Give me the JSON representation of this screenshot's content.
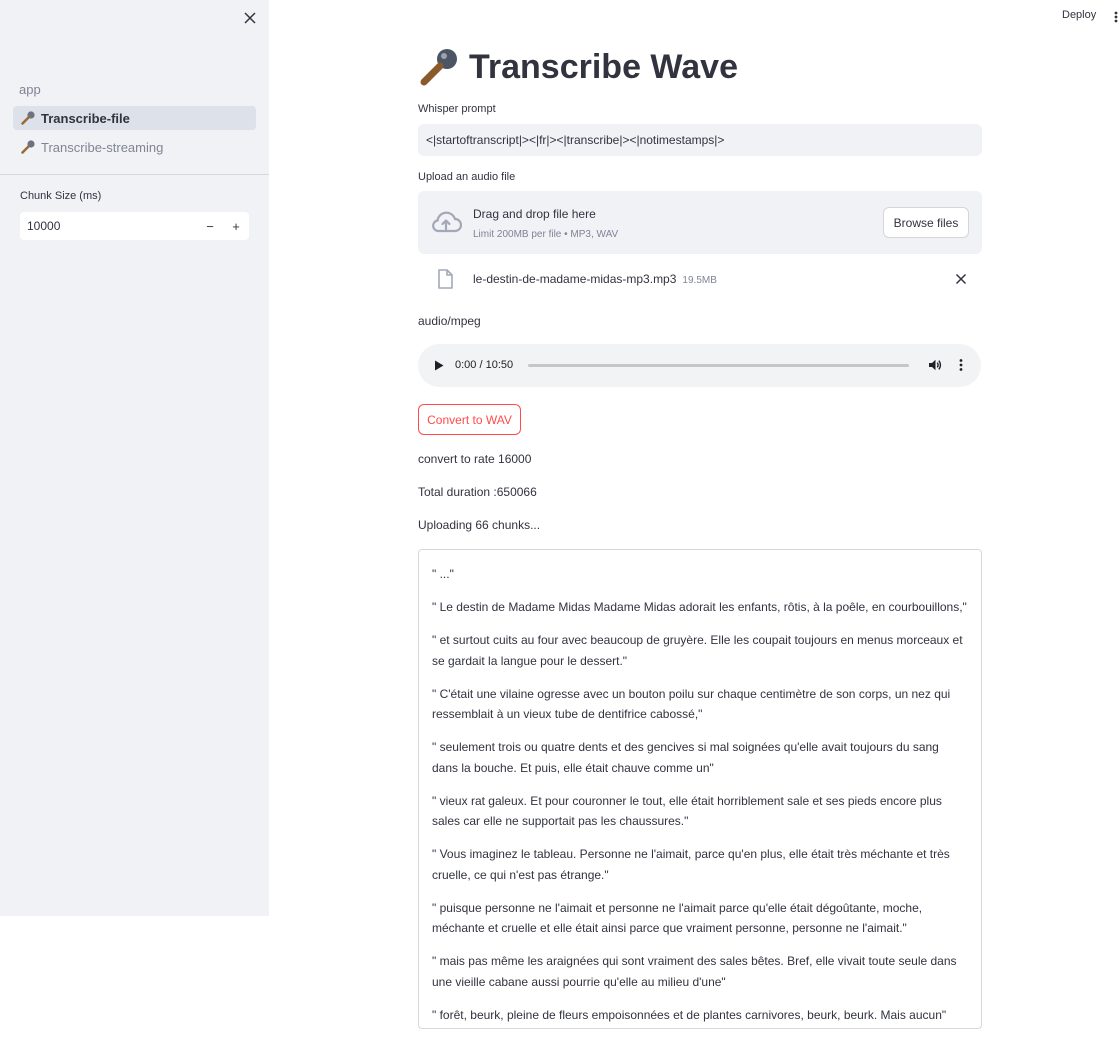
{
  "header": {
    "deploy_label": "Deploy",
    "menu_icon": "kebab-menu-icon"
  },
  "sidebar": {
    "close_icon": "close-icon",
    "section_label": "app",
    "items": [
      {
        "label": "Transcribe-file",
        "icon": "microphone-icon",
        "active": true
      },
      {
        "label": "Transcribe-streaming",
        "icon": "microphone-icon",
        "active": false
      }
    ],
    "chunk_size": {
      "label": "Chunk Size (ms)",
      "value": "10000",
      "decrement": "−",
      "increment": "+"
    }
  },
  "main": {
    "title": "Transcribe Wave",
    "title_icon": "microphone-icon",
    "prompt": {
      "label": "Whisper prompt",
      "value": "<|startoftranscript|><|fr|><|transcribe|><|notimestamps|>"
    },
    "uploader": {
      "label": "Upload an audio file",
      "drop_text": "Drag and drop file here",
      "limit_text": "Limit 200MB per file • MP3, WAV",
      "browse_label": "Browse files",
      "icon": "cloud-upload-icon"
    },
    "file": {
      "name": "le-destin-de-madame-midas-mp3.mp3",
      "size": "19.5MB",
      "icon": "file-icon"
    },
    "mime_type": "audio/mpeg",
    "audio": {
      "time": "0:00 / 10:50",
      "progress": 0
    },
    "convert_label": "Convert to WAV",
    "status_lines": [
      "convert to rate 16000",
      "Total duration :650066",
      "Uploading 66 chunks..."
    ],
    "transcript": [
      "\" ...\"",
      "\" Le destin de Madame Midas Madame Midas adorait les enfants, rôtis, à la poêle, en courbouillons,\"",
      "\" et surtout cuits au four avec beaucoup de gruyère. Elle les coupait toujours en menus morceaux et se gardait la langue pour le dessert.\"",
      "\" C'était une vilaine ogresse avec un bouton poilu sur chaque centimètre de son corps, un nez qui ressemblait à un vieux tube de dentifrice cabossé,\"",
      "\" seulement trois ou quatre dents et des gencives si mal soignées qu'elle avait toujours du sang dans la bouche. Et puis, elle était chauve comme un\"",
      "\" vieux rat galeux. Et pour couronner le tout, elle était horriblement sale et ses pieds encore plus sales car elle ne supportait pas les chaussures.\"",
      "\" Vous imaginez le tableau. Personne ne l'aimait, parce qu'en plus, elle était très méchante et très cruelle, ce qui n'est pas étrange.\"",
      "\" puisque personne ne l'aimait et personne ne l'aimait parce qu'elle était dégoûtante, moche, méchante et cruelle et elle était ainsi parce que vraiment personne, personne ne l'aimait.\"",
      "\" mais pas même les araignées qui sont vraiment des sales bêtes. Bref, elle vivait toute seule dans une vieille cabane aussi pourrie qu'elle au milieu d'une\"",
      "\" forêt, beurk, pleine de fleurs empoisonnées et de plantes carnivores, beurk, beurk. Mais aucun\""
    ]
  },
  "colors": {
    "sidebar_bg": "#f0f2f6",
    "accent": "#ff4b4b",
    "text": "#31333f",
    "muted": "#808495"
  }
}
